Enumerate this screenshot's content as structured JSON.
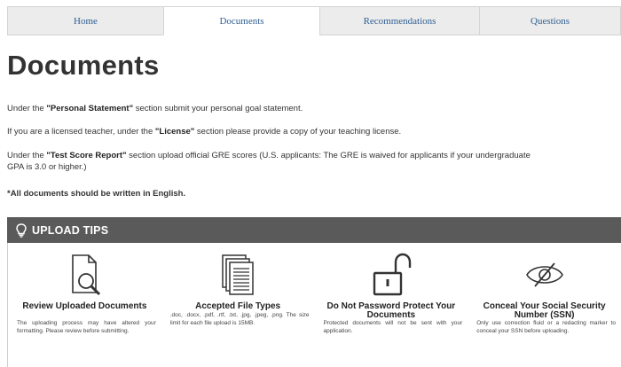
{
  "tabs": [
    {
      "label": "Home",
      "active": false
    },
    {
      "label": "Documents",
      "active": true
    },
    {
      "label": "Recommendations",
      "active": false
    },
    {
      "label": "Questions",
      "active": false
    }
  ],
  "page": {
    "title": "Documents",
    "para1": {
      "pre": "Under the ",
      "hl": "\"Personal Statement\"",
      "post": " section submit your personal goal statement."
    },
    "para2": {
      "pre": "If you are a licensed teacher, under the ",
      "hl": "\"License\"",
      "post": " section please provide a copy of your teaching license."
    },
    "para3": {
      "pre": "Under the ",
      "hl": "\"Test Score Report\"",
      "post": " section upload official GRE scores (U.S. applicants: The GRE is waived for applicants if your undergraduate GPA is 3.0 or higher.)"
    },
    "note": "*All documents should be written in English."
  },
  "upload_tips": {
    "banner": "UPLOAD TIPS",
    "items": [
      {
        "icon": "document-magnifier-icon",
        "title": "Review Uploaded Documents",
        "text": "The uploading process may have altered your formatting. Please review before submitting."
      },
      {
        "icon": "stacked-documents-icon",
        "title": "Accepted File Types",
        "text": ".doc, .docx, .pdf, .rtf, .txt, .jpg, .jpeg, .png. The size limit for each file upload is 15MB."
      },
      {
        "icon": "unlocked-padlock-icon",
        "title": "Do Not Password Protect Your Documents",
        "text": "Protected documents will not be sent with your application."
      },
      {
        "icon": "eye-slash-icon",
        "title": "Conceal Your Social Security Number (SSN)",
        "text": "Only use correction fluid or a redacting marker to conceal your SSN before uploading."
      }
    ]
  },
  "colors": {
    "tab_text": "#2f5f92",
    "banner_bg": "#5a5a5a"
  }
}
